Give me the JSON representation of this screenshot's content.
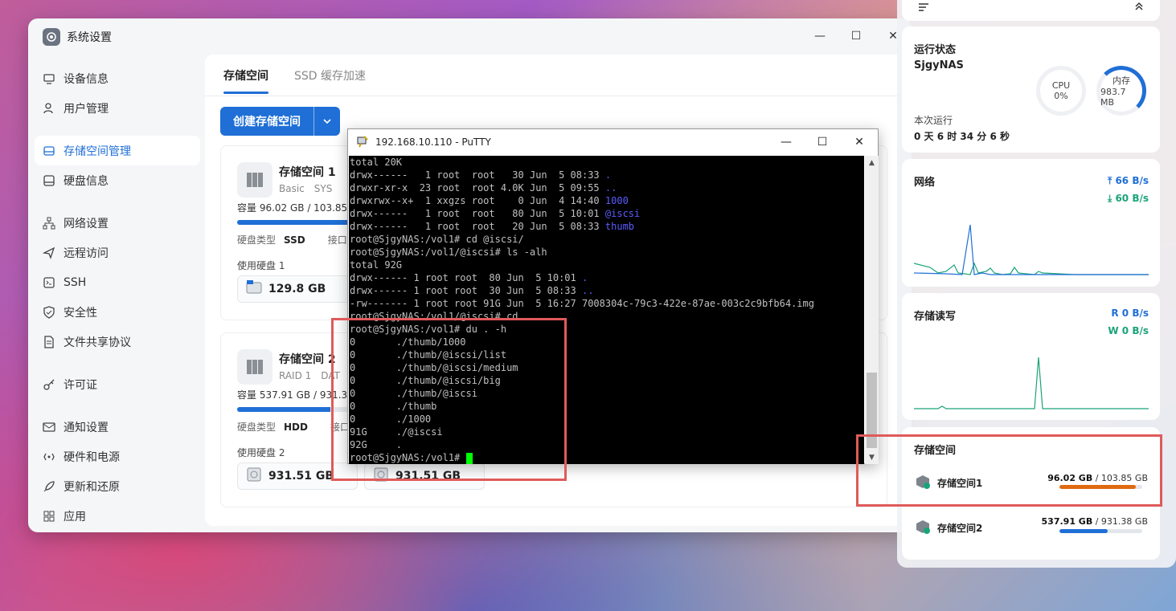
{
  "window": {
    "title": "系统设置"
  },
  "sidebar": {
    "items": [
      {
        "label": "设备信息",
        "icon": "monitor-icon"
      },
      {
        "label": "用户管理",
        "icon": "user-icon"
      },
      {
        "label": "存储空间管理",
        "icon": "storage-icon",
        "active": true
      },
      {
        "label": "硬盘信息",
        "icon": "disk-icon"
      },
      {
        "label": "网络设置",
        "icon": "network-icon"
      },
      {
        "label": "远程访问",
        "icon": "send-icon"
      },
      {
        "label": "SSH",
        "icon": "ssh-icon"
      },
      {
        "label": "安全性",
        "icon": "shield-icon"
      },
      {
        "label": "文件共享协议",
        "icon": "file-icon"
      },
      {
        "label": "许可证",
        "icon": "key-icon"
      },
      {
        "label": "通知设置",
        "icon": "mail-icon"
      },
      {
        "label": "硬件和电源",
        "icon": "power-icon"
      },
      {
        "label": "更新和还原",
        "icon": "rocket-icon"
      },
      {
        "label": "应用",
        "icon": "apps-icon"
      }
    ]
  },
  "tabs": [
    {
      "label": "存储空间",
      "active": true
    },
    {
      "label": "SSD 缓存加速",
      "active": false
    }
  ],
  "create_button": "创建存储空间",
  "pools": [
    {
      "name": "存储空间 1",
      "tag1": "Basic",
      "tag2": "SYS",
      "capacity": "容量  96.02 GB / 103.85 G",
      "usage_fraction": 0.925,
      "type_label": "硬盘类型",
      "type_value": "SSD",
      "iface_label": "接口协",
      "disks_label": "使用硬盘 1",
      "disks": [
        "129.8 GB"
      ]
    },
    {
      "name": "存储空间 2",
      "tag1": "RAID 1",
      "tag2": "DAT",
      "capacity": "容量  537.91 GB / 931.38",
      "usage_fraction": 0.578,
      "type_label": "硬盘类型",
      "type_value": "HDD",
      "iface_label": "接口协",
      "disks_label": "使用硬盘 2",
      "disks": [
        "931.51 GB",
        "931.51 GB"
      ]
    }
  ],
  "putty": {
    "title": "192.168.10.110 - PuTTY",
    "lines": [
      {
        "t": "total 20K"
      },
      {
        "t": "drwx------   1 root  root   30 Jun  5 08:33 ",
        "b": "."
      },
      {
        "t": "drwxr-xr-x  23 root  root 4.0K Jun  5 09:55 ",
        "b": ".."
      },
      {
        "t": "drwxrwx--x+  1 xxgzs root    0 Jun  4 14:40 ",
        "b": "1000"
      },
      {
        "t": "drwx------   1 root  root   80 Jun  5 10:01 ",
        "b": "@iscsi"
      },
      {
        "t": "drwx------   1 root  root   20 Jun  5 08:33 ",
        "b": "thumb"
      },
      {
        "t": "root@SjgyNAS:/vol1# cd @iscsi/"
      },
      {
        "t": "root@SjgyNAS:/vol1/@iscsi# ls -alh"
      },
      {
        "t": "total 92G"
      },
      {
        "t": "drwx------ 1 root root  80 Jun  5 10:01 ",
        "b": "."
      },
      {
        "t": "drwx------ 1 root root  30 Jun  5 08:33 ",
        "b": ".."
      },
      {
        "t": "-rw------- 1 root root 91G Jun  5 16:27 7008304c-79c3-422e-87ae-003c2c9bfb64.img"
      },
      {
        "t": "root@SjgyNAS:/vol1/@iscsi# cd .."
      },
      {
        "t": "root@SjgyNAS:/vol1# du . -h"
      },
      {
        "t": "0       ./thumb/1000"
      },
      {
        "t": "0       ./thumb/@iscsi/list"
      },
      {
        "t": "0       ./thumb/@iscsi/medium"
      },
      {
        "t": "0       ./thumb/@iscsi/big"
      },
      {
        "t": "0       ./thumb/@iscsi"
      },
      {
        "t": "0       ./thumb"
      },
      {
        "t": "0       ./1000"
      },
      {
        "t": "91G     ./@iscsi"
      },
      {
        "t": "92G     ."
      }
    ],
    "prompt": "root@SjgyNAS:/vol1# "
  },
  "right_panel": {
    "status": {
      "title": "运行状态",
      "host": "SjgyNAS",
      "cpu_label": "CPU",
      "cpu_value": "0%",
      "cpu_fraction": 0,
      "mem_label": "内存",
      "mem_value": "983.7 MB",
      "mem_fraction": 0.3,
      "uptime_label": "本次运行",
      "uptime_value": "0 天 6 时 34 分 6 秒"
    },
    "network": {
      "title": "网络",
      "up": "66 B/s",
      "down": "60 B/s"
    },
    "storage_io": {
      "title": "存储读写",
      "read": "R  0 B/s",
      "write": "W  0 B/s"
    },
    "storage": {
      "title": "存储空间",
      "pools": [
        {
          "name": "存储空间1",
          "used": "96.02 GB",
          "total": "/ 103.85 GB",
          "fraction": 0.925,
          "color": "#e06a10"
        },
        {
          "name": "存储空间2",
          "used": "537.91 GB",
          "total": "/ 931.38 GB",
          "fraction": 0.578,
          "color": "#1f6fd6"
        }
      ]
    }
  },
  "colors": {
    "accent": "#1f6fd6",
    "net_green": "#1aa37a",
    "highlight": "#e05a5a"
  }
}
